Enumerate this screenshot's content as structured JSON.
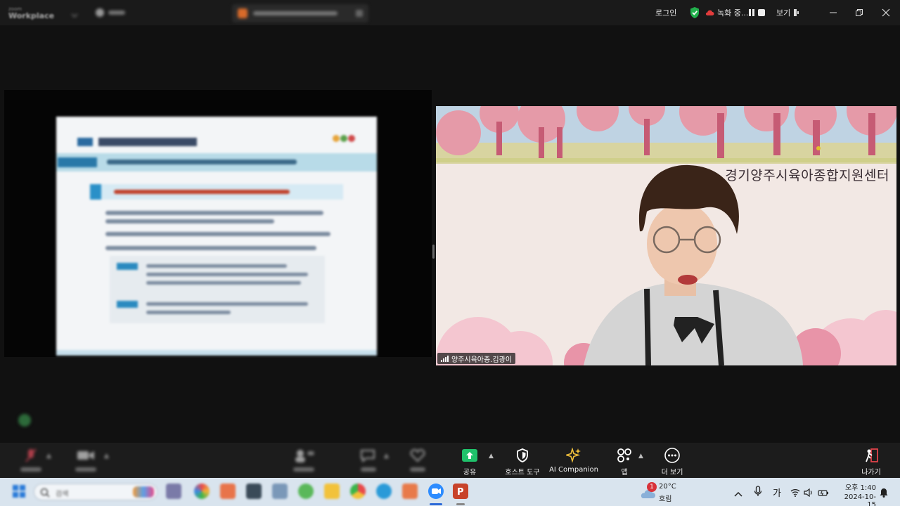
{
  "titlebar": {
    "brand_line1": "zoom",
    "brand_line2": "Workplace",
    "login_label": "로그인",
    "recording_label": "녹화 중...",
    "view_label": "보기",
    "minimize_icon": "minimize-icon",
    "maximize_icon": "restore-icon",
    "close_icon": "close-icon"
  },
  "video": {
    "participant_name": "양주시육아종.김광이",
    "banner_text": "경기양주시육아종합지원센터"
  },
  "toolbar": {
    "share_label": "공유",
    "host_tools_label": "호스트 도구",
    "ai_companion_label": "AI Companion",
    "apps_label": "앱",
    "more_label": "더 보기",
    "leave_label": "나가기",
    "colors": {
      "share_green": "#1fc26b",
      "ai_gold": "#f2c13b",
      "leave_red": "#e0424a"
    }
  },
  "taskbar": {
    "search_placeholder": "검색",
    "weather_temp": "20°C",
    "weather_desc": "흐림",
    "weather_badge": "1",
    "ime_label": "가",
    "time": "오후 1:40",
    "date": "2024-10-15"
  }
}
